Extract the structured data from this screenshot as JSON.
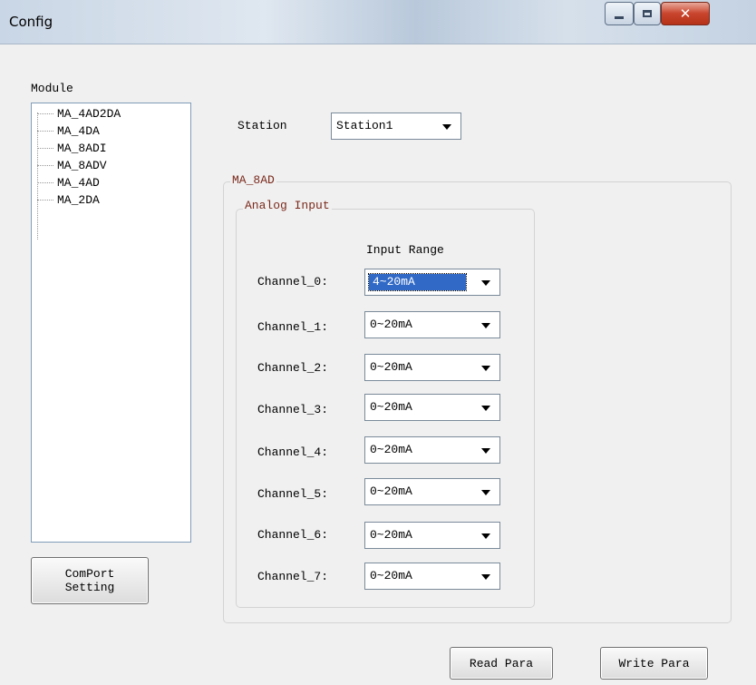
{
  "window": {
    "title": "Config"
  },
  "module": {
    "label": "Module",
    "items": [
      "MA_4AD2DA",
      "MA_4DA",
      "MA_8ADI",
      "MA_8ADV",
      "MA_4AD",
      "MA_2DA"
    ]
  },
  "station": {
    "label": "Station",
    "value": "Station1"
  },
  "group": {
    "title": "MA_8AD"
  },
  "analog": {
    "title": "Analog Input",
    "range_header": "Input Range",
    "channels": [
      {
        "label": "Channel_0:",
        "value": "4~20mA"
      },
      {
        "label": "Channel_1:",
        "value": "0~20mA"
      },
      {
        "label": "Channel_2:",
        "value": "0~20mA"
      },
      {
        "label": "Channel_3:",
        "value": "0~20mA"
      },
      {
        "label": "Channel_4:",
        "value": "0~20mA"
      },
      {
        "label": "Channel_5:",
        "value": "0~20mA"
      },
      {
        "label": "Channel_6:",
        "value": "0~20mA"
      },
      {
        "label": "Channel_7:",
        "value": "0~20mA"
      }
    ]
  },
  "buttons": {
    "comport_line1": "ComPort",
    "comport_line2": "Setting",
    "read": "Read Para",
    "write": "Write Para"
  },
  "colors": {
    "selection": "#3169c6",
    "group_title": "#7a2a1c"
  }
}
